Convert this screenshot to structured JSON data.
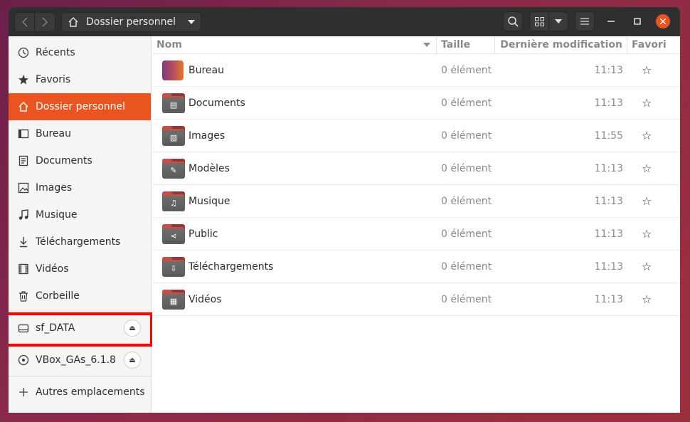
{
  "header": {
    "path_title": "Dossier personnel"
  },
  "sidebar": {
    "items": [
      {
        "label": "Récents",
        "icon": "clock-icon"
      },
      {
        "label": "Favoris",
        "icon": "star-icon"
      },
      {
        "label": "Dossier personnel",
        "icon": "home-icon",
        "active": true
      },
      {
        "label": "Bureau",
        "icon": "desktop-icon"
      },
      {
        "label": "Documents",
        "icon": "document-icon"
      },
      {
        "label": "Images",
        "icon": "image-icon"
      },
      {
        "label": "Musique",
        "icon": "music-icon"
      },
      {
        "label": "Téléchargements",
        "icon": "download-icon"
      },
      {
        "label": "Vidéos",
        "icon": "video-icon"
      },
      {
        "label": "Corbeille",
        "icon": "trash-icon"
      }
    ],
    "devices": [
      {
        "label": "sf_DATA",
        "icon": "drive-icon"
      },
      {
        "label": "VBox_GAs_6.1.8",
        "icon": "disc-icon"
      }
    ],
    "other_locations": "Autres emplacements"
  },
  "columns": {
    "name": "Nom",
    "size": "Taille",
    "date": "Dernière modification",
    "fav": "Favori"
  },
  "files": [
    {
      "name": "Bureau",
      "size": "0 élément",
      "date": "11:13"
    },
    {
      "name": "Documents",
      "size": "0 élément",
      "date": "11:13"
    },
    {
      "name": "Images",
      "size": "0 élément",
      "date": "11:55"
    },
    {
      "name": "Modèles",
      "size": "0 élément",
      "date": "11:13"
    },
    {
      "name": "Musique",
      "size": "0 élément",
      "date": "11:13"
    },
    {
      "name": "Public",
      "size": "0 élément",
      "date": "11:13"
    },
    {
      "name": "Téléchargements",
      "size": "0 élément",
      "date": "11:13"
    },
    {
      "name": "Vidéos",
      "size": "0 élément",
      "date": "11:13"
    }
  ],
  "colors": {
    "accent": "#e95420",
    "highlight": "#ff0000"
  }
}
